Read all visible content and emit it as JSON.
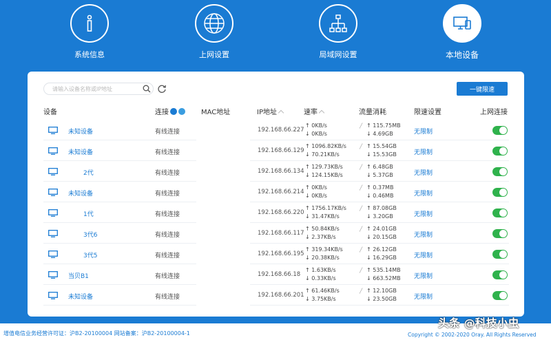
{
  "nav": [
    {
      "label": "系统信息",
      "icon": "info-icon",
      "active": false
    },
    {
      "label": "上网设置",
      "icon": "globe-icon",
      "active": false
    },
    {
      "label": "局域网设置",
      "icon": "lan-icon",
      "active": false
    },
    {
      "label": "本地设备",
      "icon": "devices-icon",
      "active": true
    }
  ],
  "toolbar": {
    "search_placeholder": "请输入设备名称或IP地址",
    "oneclick_label": "一键限速"
  },
  "table": {
    "headers": {
      "device": "设备",
      "connection": "连接",
      "mac": "MAC地址",
      "ip": "IP地址",
      "rate": "速率",
      "traffic": "流量消耗",
      "limit": "限速设置",
      "online": "上网连接"
    },
    "rows": [
      {
        "name": "未知设备",
        "conn": "有线连接",
        "ip": "192.168.66.227",
        "up": "↑ 0KB/s",
        "down": "↓ 0KB/s",
        "t_up": "↑ 115.75MB",
        "t_down": "↓ 4.69GB",
        "limit": "无限制",
        "online": true
      },
      {
        "name": "未知设备",
        "conn": "有线连接",
        "ip": "192.168.66.129",
        "up": "↑ 1096.82KB/s",
        "down": "↓ 70.21KB/s",
        "t_up": "↑ 15.54GB",
        "t_down": "↓ 15.53GB",
        "limit": "无限制",
        "online": true
      },
      {
        "name": "2代",
        "conn": "有线连接",
        "ip": "192.168.66.134",
        "up": "↑ 129.73KB/s",
        "down": "↓ 124.15KB/s",
        "t_up": "↑ 6.48GB",
        "t_down": "↓ 5.37GB",
        "limit": "无限制",
        "online": true
      },
      {
        "name": "未知设备",
        "conn": "有线连接",
        "ip": "192.168.66.214",
        "up": "↑ 0KB/s",
        "down": "↓ 0KB/s",
        "t_up": "↑ 0.37MB",
        "t_down": "↓ 0.46MB",
        "limit": "无限制",
        "online": true
      },
      {
        "name": "1代",
        "conn": "有线连接",
        "ip": "192.168.66.220",
        "up": "↑ 1756.17KB/s",
        "down": "↓ 31.47KB/s",
        "t_up": "↑ 87.08GB",
        "t_down": "↓ 3.20GB",
        "limit": "无限制",
        "online": true
      },
      {
        "name": "3代6",
        "conn": "有线连接",
        "ip": "192.168.66.117",
        "up": "↑ 50.84KB/s",
        "down": "↓ 2.37KB/s",
        "t_up": "↑ 24.01GB",
        "t_down": "↓ 20.15GB",
        "limit": "无限制",
        "online": true
      },
      {
        "name": "3代5",
        "conn": "有线连接",
        "ip": "192.168.66.195",
        "up": "↑ 319.34KB/s",
        "down": "↓ 20.38KB/s",
        "t_up": "↑ 26.12GB",
        "t_down": "↓ 16.29GB",
        "limit": "无限制",
        "online": true
      },
      {
        "name": "当贝B1",
        "conn": "有线连接",
        "ip": "192.168.66.18",
        "up": "↑ 1.63KB/s",
        "down": "↓ 0.33KB/s",
        "t_up": "↑ 535.14MB",
        "t_down": "↓ 663.52MB",
        "limit": "无限制",
        "online": true
      },
      {
        "name": "未知设备",
        "conn": "有线连接",
        "ip": "192.168.66.201",
        "up": "↑ 61.46KB/s",
        "down": "↓ 3.75KB/s",
        "t_up": "↑ 12.10GB",
        "t_down": "↓ 23.50GB",
        "limit": "无限制",
        "online": true
      }
    ]
  },
  "footer": {
    "left": "增值电信业务经营许可证：沪B2-20100004 网站备案：沪B2-20100004-1",
    "right": "Copyright © 2002-2020 Oray. All Rights Reserved"
  },
  "watermark": "头条 @科技小虫",
  "colors": {
    "brand": "#1a7bd3",
    "toggle_on": "#2fb24c"
  }
}
